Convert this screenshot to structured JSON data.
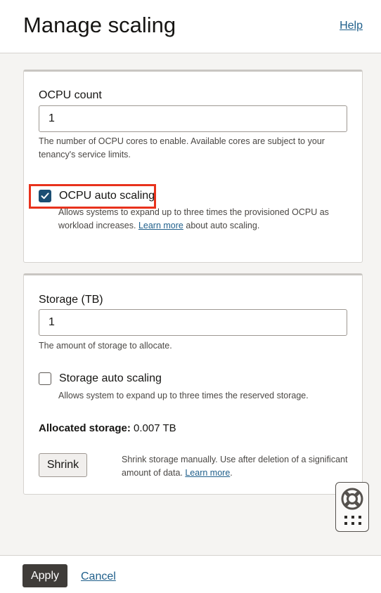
{
  "header": {
    "title": "Manage scaling",
    "help_link": "Help"
  },
  "ocpu": {
    "count_label": "OCPU count",
    "count_value": "1",
    "count_help": "The number of OCPU cores to enable. Available cores are subject to your tenancy's service limits.",
    "auto_scaling_label": "OCPU auto scaling",
    "auto_scaling_checked": true,
    "auto_scaling_help_pre": "Allows systems to expand up to three times the provisioned OCPU as workload increases.",
    "auto_scaling_help_link": "Learn more",
    "auto_scaling_help_post": "about auto scaling."
  },
  "storage": {
    "label": "Storage (TB)",
    "value": "1",
    "help": "The amount of storage to allocate.",
    "auto_scaling_label": "Storage auto scaling",
    "auto_scaling_checked": false,
    "auto_scaling_help": "Allows system to expand up to three times the reserved storage.",
    "allocated_label": "Allocated storage:",
    "allocated_value": "0.007 TB",
    "shrink_button": "Shrink",
    "shrink_help_pre": "Shrink storage manually. Use after deletion of a significant amount of data.",
    "shrink_help_link": "Learn more",
    "shrink_help_post": "."
  },
  "footer": {
    "apply_button": "Apply",
    "cancel_link": "Cancel"
  },
  "colors": {
    "accent": "#1b4e73",
    "link": "#1f5f8b",
    "highlight": "#e8321c",
    "primary_button": "#3f3c39"
  },
  "icons": {
    "float_widget_top": "lifebuoy-icon",
    "float_widget_bottom": "grid-dots-icon"
  }
}
